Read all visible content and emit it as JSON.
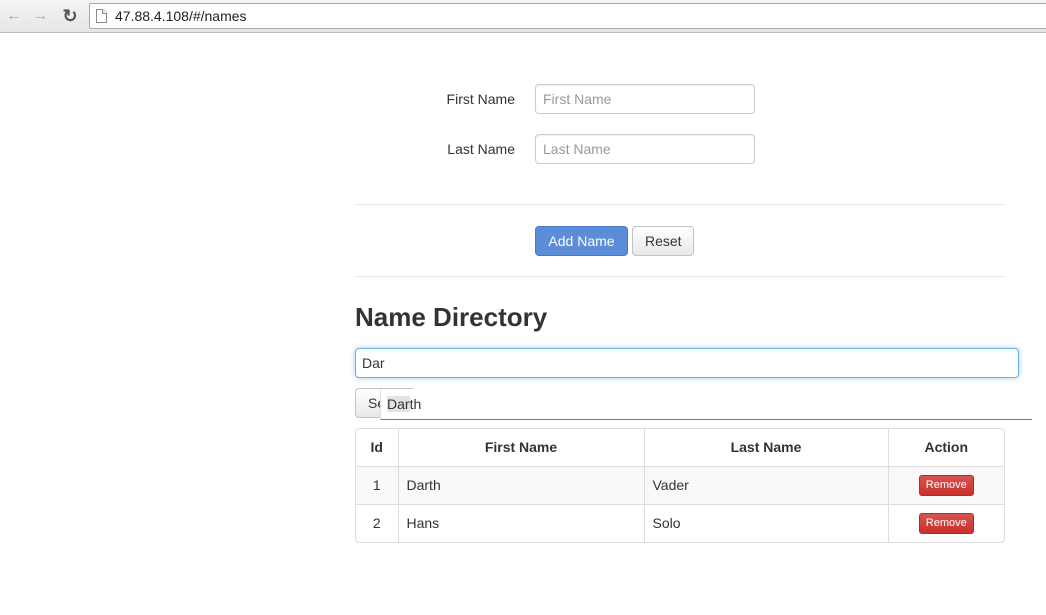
{
  "browser": {
    "back_icon": "back-arrow-icon",
    "forward_icon": "forward-arrow-icon",
    "reload_icon": "reload-icon",
    "url": "47.88.4.108/#/names"
  },
  "form": {
    "first_name_label": "First Name",
    "first_name_placeholder": "First Name",
    "first_name_value": "",
    "last_name_label": "Last Name",
    "last_name_placeholder": "Last Name",
    "last_name_value": "",
    "add_button_label": "Add Name",
    "reset_button_label": "Reset"
  },
  "directory": {
    "title": "Name Directory",
    "search_value": "Dar",
    "search_button_label": "Search",
    "autocomplete": {
      "match": "Dar",
      "rest": "th"
    },
    "columns": [
      "Id",
      "First Name",
      "Last Name",
      "Action"
    ],
    "rows": [
      {
        "id": "1",
        "first": "Darth",
        "last": "Vader",
        "action": "Remove"
      },
      {
        "id": "2",
        "first": "Hans",
        "last": "Solo",
        "action": "Remove"
      }
    ]
  },
  "colors": {
    "primary": "#5b8dd9",
    "danger": "#d9534f",
    "focus": "#66afe9"
  }
}
